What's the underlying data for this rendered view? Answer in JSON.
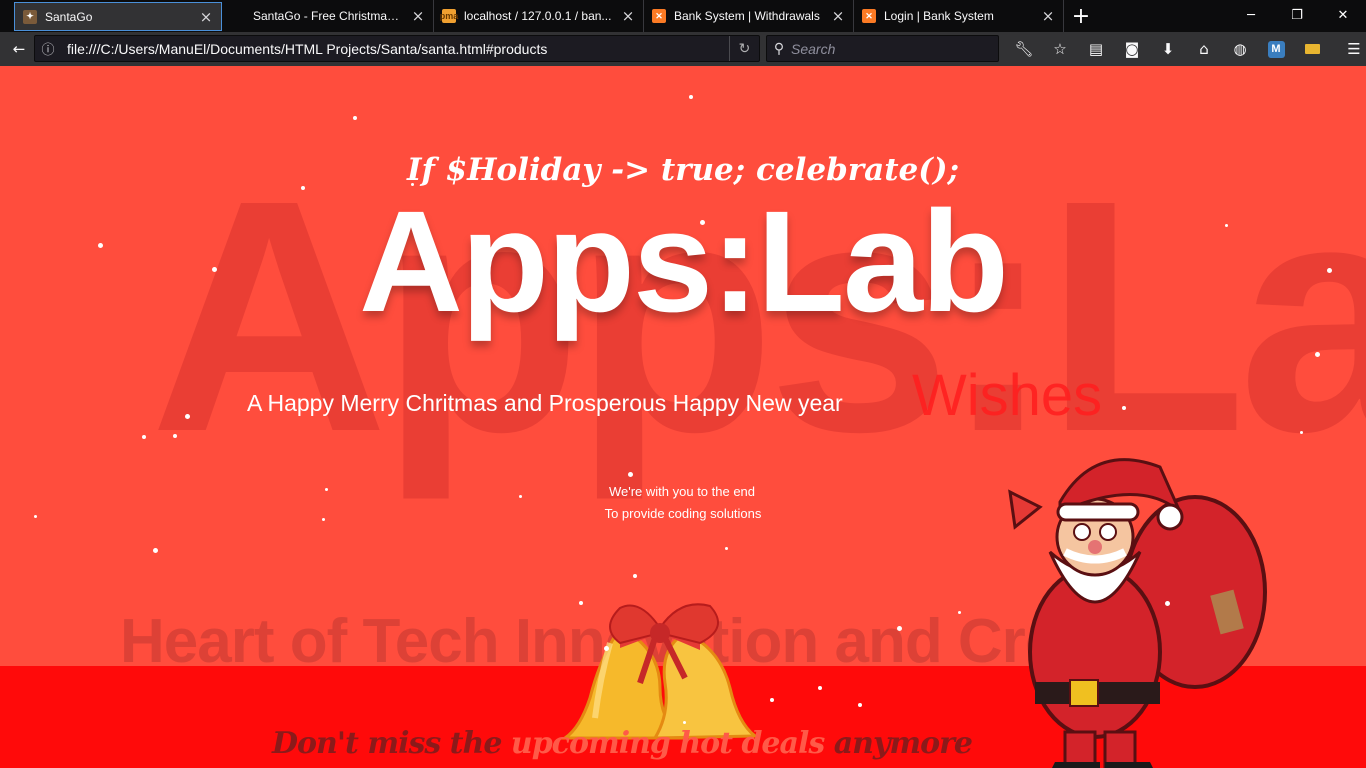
{
  "browser": {
    "tabs": [
      {
        "label": "SantaGo",
        "icon": "santa-favicon",
        "active": true
      },
      {
        "label": "SantaGo - Free Christmas ...",
        "icon": "none"
      },
      {
        "label": "localhost / 127.0.0.1 / ban...",
        "icon": "phpmyadmin-icon"
      },
      {
        "label": "Bank System | Withdrawals",
        "icon": "xampp-icon"
      },
      {
        "label": "Login | Bank System",
        "icon": "xampp-icon"
      }
    ],
    "url": "file:///C:/Users/ManuEl/Documents/HTML Projects/Santa/santa.html#products",
    "search_placeholder": "Search"
  },
  "page": {
    "tagline": "If $Holiday -> true; celebrate();",
    "logo": "Apps:Lab",
    "bg_logo": "Apps:Lab",
    "bg_subtitle": "Heart of Tech Innovation and Creativity",
    "greeting": "A Happy Merry Chritmas and Prosperous Happy New year",
    "wishes": "Wishes",
    "sub_line1": "We're with you to the end",
    "sub_line2": "To provide coding solutions",
    "deals_prefix": "Don't miss the ",
    "deals_highlight": "upcoming hot deals",
    "deals_suffix": " anymore"
  },
  "colors": {
    "background": "#ff4d3d",
    "band": "#ff0a0a",
    "browser_chrome": "#323234"
  }
}
